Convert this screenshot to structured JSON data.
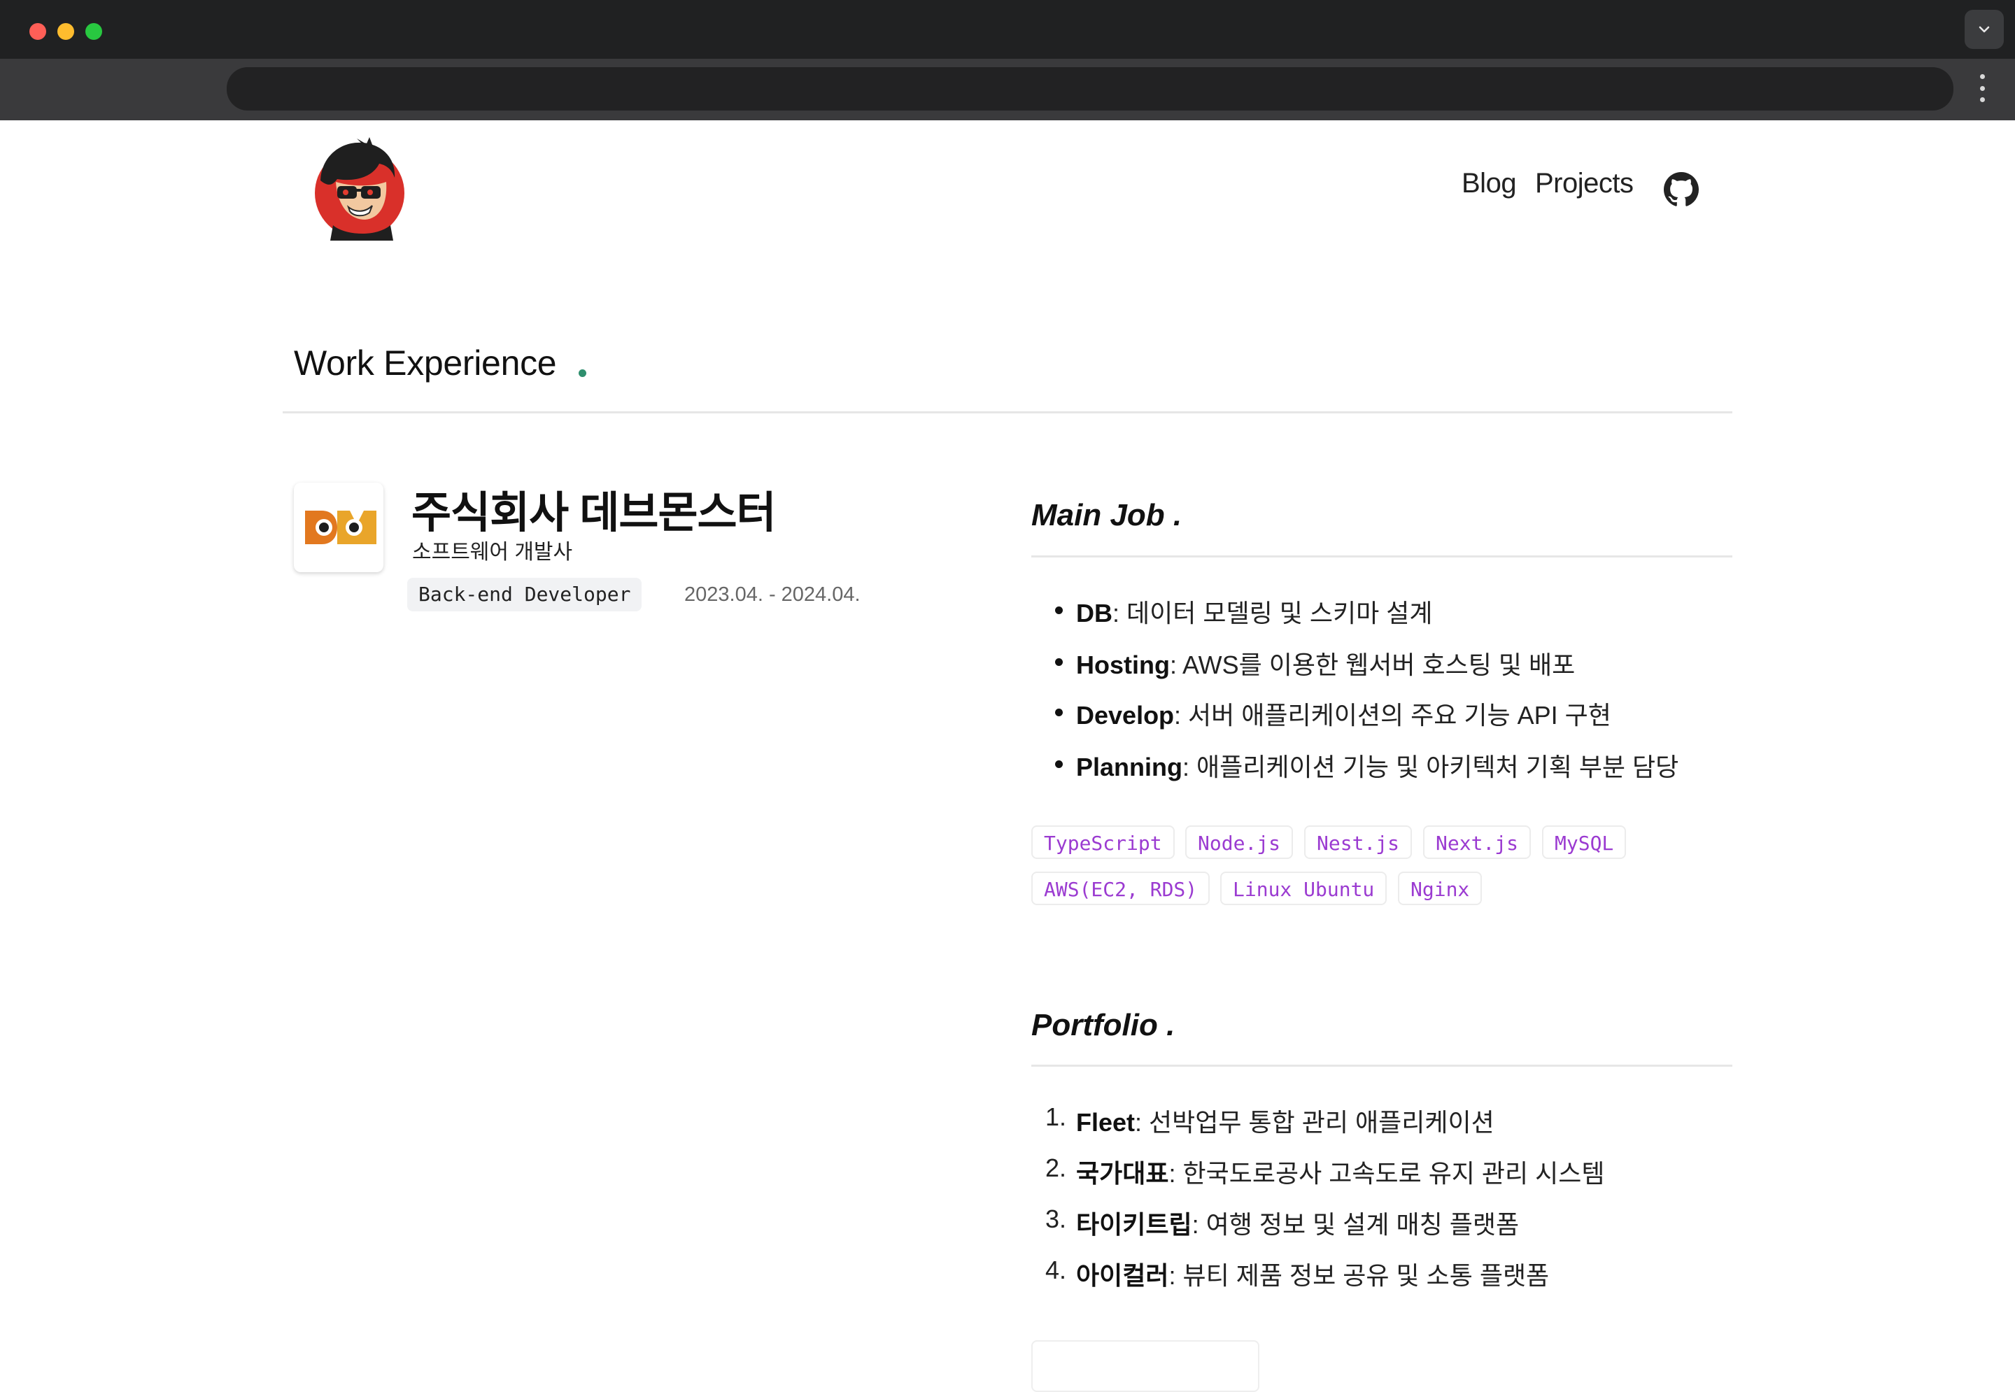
{
  "browser": {
    "url": "",
    "tab_menu_icon": "chevron-down-icon",
    "menu_icon": "kebab-icon"
  },
  "header": {
    "avatar_icon": "avatar-illustration",
    "nav": [
      {
        "label": "Blog"
      },
      {
        "label": "Projects"
      }
    ],
    "github_icon": "github-icon"
  },
  "section": {
    "title": "Work Experience",
    "accent": "#2f8f6e"
  },
  "company": {
    "name": "주식회사 데브몬스터",
    "type": "소프트웨어 개발사",
    "role": "Back-end Developer",
    "period": "2023.04. - 2024.04.",
    "logo_icon": "devmonster-logo"
  },
  "main_job": {
    "title": "Main Job .",
    "items": [
      {
        "key": "DB",
        "text": ": 데이터 모델링 및 스키마 설계"
      },
      {
        "key": "Hosting",
        "text": ": AWS를 이용한 웹서버 호스팅 및 배포"
      },
      {
        "key": "Develop",
        "text": ": 서버 애플리케이션의 주요 기능 API 구현"
      },
      {
        "key": "Planning",
        "text": ": 애플리케이션 기능 및 아키텍처 기획 부분 담당"
      }
    ],
    "tags": [
      "TypeScript",
      "Node.js",
      "Nest.js",
      "Next.js",
      "MySQL",
      "AWS(EC2, RDS)",
      "Linux Ubuntu",
      "Nginx"
    ],
    "tag_color": "#9b3bd1"
  },
  "portfolio": {
    "title": "Portfolio .",
    "items": [
      {
        "num": "1.",
        "key": "Fleet",
        "text": ": 선박업무 통합 관리 애플리케이션"
      },
      {
        "num": "2.",
        "key": "국가대표",
        "text": ": 한국도로공사 고속도로 유지 관리 시스템"
      },
      {
        "num": "3.",
        "key": "타이키트립",
        "text": ": 여행 정보 및 설계 매칭 플랫폼"
      },
      {
        "num": "4.",
        "key": "아이컬러",
        "text": ": 뷰티 제품 정보 공유 및 소통 플랫폼"
      }
    ]
  }
}
